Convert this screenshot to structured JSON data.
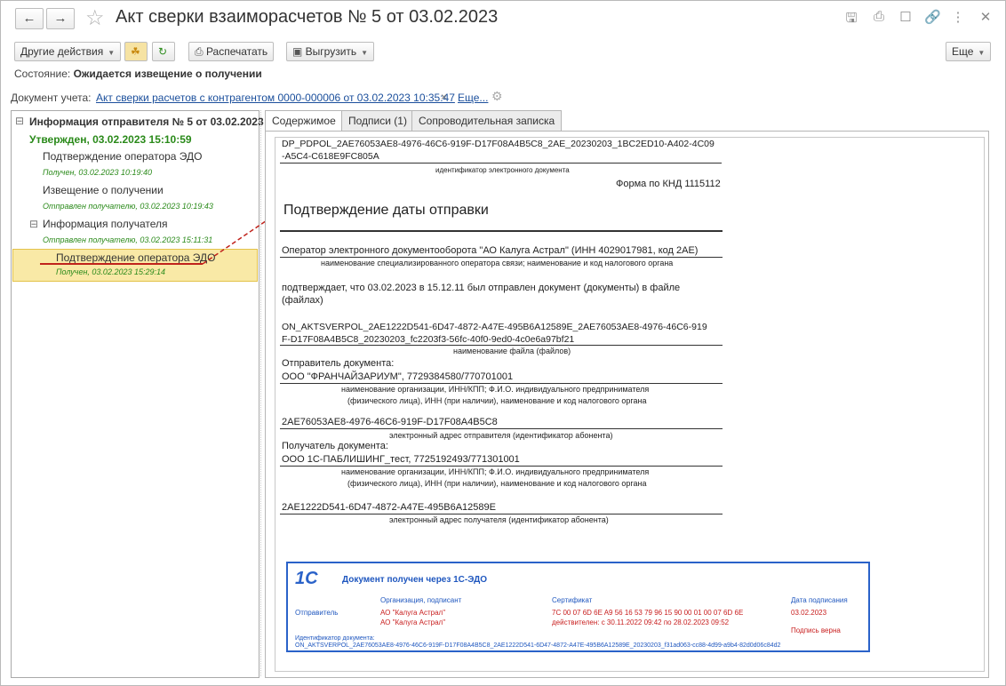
{
  "window": {
    "title": "Акт сверки взаиморасчетов № 5 от 03.02.2023",
    "back_icon": "arrow-left-icon",
    "forward_icon": "arrow-right-icon"
  },
  "toolbar": {
    "other_actions": "Другие действия",
    "print": "Распечатать",
    "export": "Выгрузить",
    "more": "Еще"
  },
  "status": {
    "label": "Состояние:",
    "value": "Ожидается извещение о получении"
  },
  "account_doc": {
    "label": "Документ учета:",
    "link": "Акт сверки расчетов с контрагентом 0000-000006 от 03.02.2023 10:35:47",
    "more_link": "Еще..."
  },
  "tree": {
    "root": "Информация отправителя № 5 от 03.02.2023",
    "approved": "Утвержден, 03.02.2023 15:10:59",
    "items": [
      {
        "title": "Подтверждение оператора ЭДО",
        "status": "Получен, 03.02.2023 10:19:40"
      },
      {
        "title": "Извещение о получении",
        "status": "Отправлен получателю, 03.02.2023 10:19:43"
      },
      {
        "title": "Информация получателя",
        "status": "Отправлен получателю, 03.02.2023 15:11:31"
      },
      {
        "title": "Подтверждение оператора ЭДО",
        "status": "Получен, 03.02.2023 15:29:14"
      }
    ]
  },
  "tabs": [
    "Содержимое",
    "Подписи (1)",
    "Сопроводительная записка"
  ],
  "doc": {
    "file_id_1": "DP_PDPOL_2AE76053AE8-4976-46C6-919F-D17F08A4B5C8_2AE_20230203_1BC2ED10-A402-4C09",
    "file_id_2": "-A5C4-C618E9FC805A",
    "file_id_caption": "идентификатор электронного документа",
    "form": "Форма по КНД 1115112",
    "heading": "Подтверждение даты отправки",
    "operator": "Оператор электронного документооборота \"АО Калуга Астрал\" (ИНН 4029017981, код 2АЕ)",
    "operator_caption": "наименование специализированного оператора связи; наименование и код налогового органа",
    "confirms_1": "подтверждает, что 03.02.2023 в 15.12.11 был отправлен документ (документы) в файле",
    "confirms_2": "(файлах)",
    "file_1": "ON_AKTSVERPOL_2AE1222D541-6D47-4872-A47E-495B6A12589E_2AE76053AE8-4976-46C6-919",
    "file_2": "F-D17F08A4B5C8_20230203_fc2203f3-56fc-40f0-9ed0-4c0e6a97bf21",
    "file_caption": "наименование файла (файлов)",
    "sender_label": "Отправитель документа:",
    "sender": "ООО \"ФРАНЧАЙЗАРИУМ\", 7729384580/770701001",
    "org_caption_1": "наименование организации, ИНН/КПП; Ф.И.О. индивидуального предпринимателя",
    "org_caption_2": "(физического лица), ИНН (при наличии), наименование и код налогового органа",
    "sender_addr": "2AE76053AE8-4976-46C6-919F-D17F08A4B5C8",
    "sender_addr_caption": "электронный адрес отправителя (идентификатор абонента)",
    "recipient_label": "Получатель документа:",
    "recipient": "ООО 1С-ПАБЛИШИНГ_тест, 7725192493/771301001",
    "recipient_addr": "2AE1222D541-6D47-4872-A47E-495B6A12589E",
    "recipient_addr_caption": "электронный адрес получателя (идентификатор абонента)"
  },
  "stamp": {
    "logo": "1С",
    "title": "Документ получен через 1С-ЭДО",
    "col_org": "Организация, подписант",
    "col_cert": "Сертификат",
    "col_date": "Дата подписания",
    "row_label": "Отправитель",
    "org_1": "АО \"Калуга Астрал\"",
    "org_2": "АО \"Калуга Астрал\"",
    "cert_1": "7C 00 07 6D 6E A9 56 16 53 79 96 15 90 00 01 00 07 6D 6E",
    "cert_2": "действителен: с 30.11.2022 09:42 по 28.02.2023 09:52",
    "date": "03.02.2023",
    "sig_status": "Подпись верна",
    "id_label": "Идентификатор документа:",
    "id_value": "ON_AKTSVERPOL_2AE76053AE8-4976-46C6-919F-D17F08A4B5C8_2AE1222D541-6D47-4872-A47E-495B6A12589E_20230203_f31ad063-cc88-4d99-a9b4-82d0d06c84d2"
  },
  "colors": {
    "accent_blue": "#1b4f9c",
    "green_text": "#2a8a1a",
    "selection": "#f9e9a6",
    "arrow_red": "#c0221b"
  }
}
